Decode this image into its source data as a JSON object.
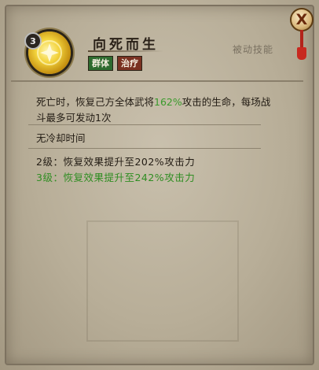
{
  "skill": {
    "level": "3",
    "name": "向死而生",
    "tags": [
      "群体",
      "治疗"
    ],
    "type_label": "被动技能"
  },
  "description": {
    "part1": "死亡时，恢复己方全体武将",
    "highlight": "162%",
    "part2": "攻击的生命，每场战斗最多可发动1次"
  },
  "cooldown": "无冷却时间",
  "upgrades": [
    {
      "text": "2级：恢复效果提升至202%攻击力",
      "color": "#231c14"
    },
    {
      "text": "3级：恢复效果提升至242%攻击力",
      "color": "#2f8d22"
    }
  ],
  "close_label": "X",
  "colors": {
    "highlight": "#3a9a2c",
    "tag_group": "#2e6b2f",
    "tag_heal": "#7a3222"
  }
}
